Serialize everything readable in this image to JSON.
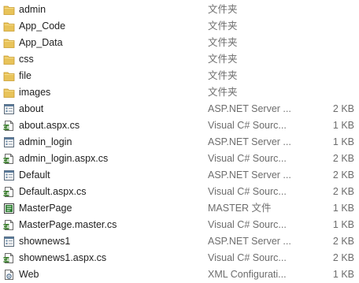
{
  "files": [
    {
      "name": "admin",
      "type": "文件夹",
      "size": "",
      "icon": "folder-icon"
    },
    {
      "name": "App_Code",
      "type": "文件夹",
      "size": "",
      "icon": "folder-icon"
    },
    {
      "name": "App_Data",
      "type": "文件夹",
      "size": "",
      "icon": "folder-icon"
    },
    {
      "name": "css",
      "type": "文件夹",
      "size": "",
      "icon": "folder-icon"
    },
    {
      "name": "file",
      "type": "文件夹",
      "size": "",
      "icon": "folder-icon"
    },
    {
      "name": "images",
      "type": "文件夹",
      "size": "",
      "icon": "folder-icon"
    },
    {
      "name": "about",
      "type": "ASP.NET Server ...",
      "size": "2 KB",
      "icon": "aspx-file-icon"
    },
    {
      "name": "about.aspx.cs",
      "type": "Visual C# Sourc...",
      "size": "1 KB",
      "icon": "csharp-file-icon"
    },
    {
      "name": "admin_login",
      "type": "ASP.NET Server ...",
      "size": "1 KB",
      "icon": "aspx-file-icon"
    },
    {
      "name": "admin_login.aspx.cs",
      "type": "Visual C# Sourc...",
      "size": "2 KB",
      "icon": "csharp-file-icon"
    },
    {
      "name": "Default",
      "type": "ASP.NET Server ...",
      "size": "2 KB",
      "icon": "aspx-file-icon"
    },
    {
      "name": "Default.aspx.cs",
      "type": "Visual C# Sourc...",
      "size": "2 KB",
      "icon": "csharp-file-icon"
    },
    {
      "name": "MasterPage",
      "type": "MASTER 文件",
      "size": "1 KB",
      "icon": "master-file-icon"
    },
    {
      "name": "MasterPage.master.cs",
      "type": "Visual C# Sourc...",
      "size": "1 KB",
      "icon": "csharp-file-icon"
    },
    {
      "name": "shownews1",
      "type": "ASP.NET Server ...",
      "size": "2 KB",
      "icon": "aspx-file-icon"
    },
    {
      "name": "shownews1.aspx.cs",
      "type": "Visual C# Sourc...",
      "size": "2 KB",
      "icon": "csharp-file-icon"
    },
    {
      "name": "Web",
      "type": "XML Configurati...",
      "size": "1 KB",
      "icon": "xml-config-file-icon"
    }
  ],
  "colors": {
    "folder": "#e8c35a",
    "text": "#1e1e1e",
    "secondary_text": "#6d6d6d",
    "master_icon": "#2e7d32",
    "csharp_badge": "#3a7d2c"
  }
}
